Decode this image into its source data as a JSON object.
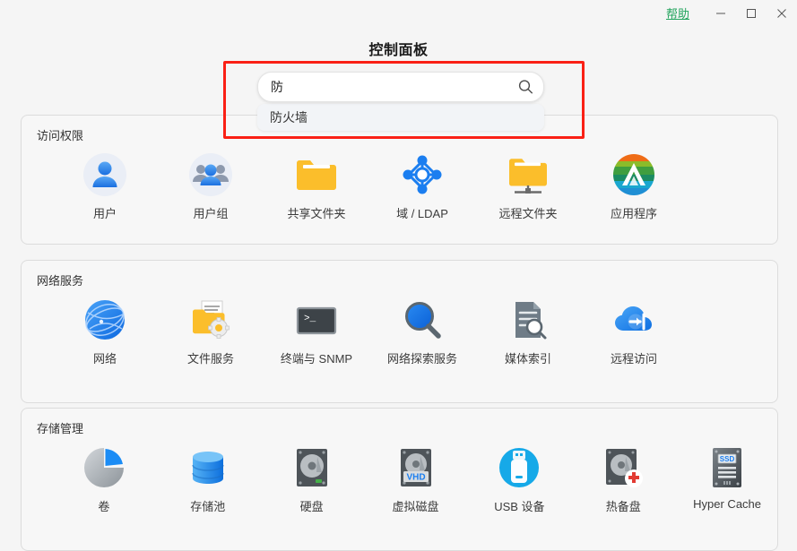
{
  "window": {
    "help_label": "帮助",
    "minimize_icon": "minimize-icon",
    "maximize_icon": "maximize-icon",
    "close_icon": "close-icon"
  },
  "page": {
    "title": "控制面板"
  },
  "search": {
    "value": "防",
    "placeholder": "",
    "icon": "search-icon",
    "suggestions": [
      {
        "label": "防火墙"
      }
    ]
  },
  "annotation": {
    "color": "#fa2015"
  },
  "sections": [
    {
      "title": "访问权限",
      "items": [
        {
          "label": "用户",
          "icon": "user-icon"
        },
        {
          "label": "用户组",
          "icon": "user-group-icon"
        },
        {
          "label": "共享文件夹",
          "icon": "shared-folder-icon"
        },
        {
          "label": "域 / LDAP",
          "icon": "domain-ldap-icon"
        },
        {
          "label": "远程文件夹",
          "icon": "remote-folder-icon"
        },
        {
          "label": "应用程序",
          "icon": "app-center-icon"
        }
      ]
    },
    {
      "title": "网络服务",
      "items": [
        {
          "label": "网络",
          "icon": "network-globe-icon"
        },
        {
          "label": "文件服务",
          "icon": "file-service-icon"
        },
        {
          "label": "终端与 SNMP",
          "icon": "terminal-snmp-icon"
        },
        {
          "label": "网络探索服务",
          "icon": "network-discovery-icon"
        },
        {
          "label": "媒体索引",
          "icon": "media-index-icon"
        },
        {
          "label": "远程访问",
          "icon": "remote-access-icon"
        }
      ]
    },
    {
      "title": "存储管理",
      "items": [
        {
          "label": "卷",
          "icon": "volume-pie-icon"
        },
        {
          "label": "存储池",
          "icon": "storage-pool-icon"
        },
        {
          "label": "硬盘",
          "icon": "hard-disk-icon"
        },
        {
          "label": "虚拟磁盘",
          "icon": "virtual-disk-icon"
        },
        {
          "label": "USB 设备",
          "icon": "usb-device-icon"
        },
        {
          "label": "热备盘",
          "icon": "hot-spare-icon"
        },
        {
          "label": "Hyper Cache",
          "icon": "hyper-cache-icon"
        }
      ]
    }
  ],
  "colors": {
    "accent_blue": "#1b7ef0",
    "folder_yellow": "#fbbe2b",
    "help_green": "#22a45d",
    "annotation_red": "#fa2015",
    "panel_bg": "#f7f7f7",
    "page_bg": "#f5f5f5"
  }
}
